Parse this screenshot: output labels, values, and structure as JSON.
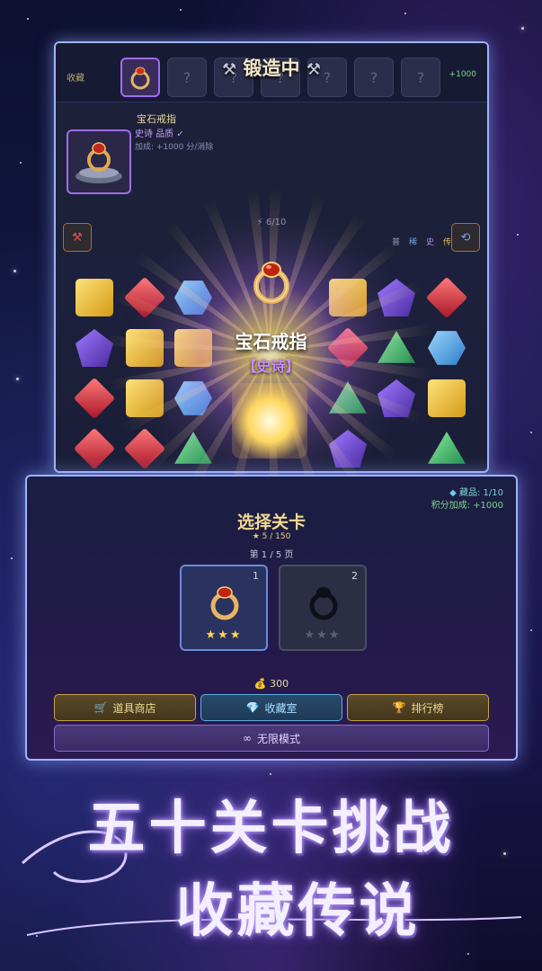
{
  "game": {
    "collect_label": "收藏",
    "forging_title": "锻造中",
    "collect_bonus": "+1000",
    "slot_placeholder": "?",
    "item": {
      "name": "宝石戒指",
      "rarity": "史诗 品质 ✓",
      "score": "加成: +1000 分/消除"
    },
    "rarity_tiers": [
      "普",
      "稀",
      "史",
      "传"
    ],
    "moves": "⚡ 6/10"
  },
  "reward": {
    "name": "宝石戒指",
    "rarity": "【史诗】"
  },
  "level_select": {
    "collect_count": "藏品: 1/10",
    "score_bonus": "积分加成: +1000",
    "title": "选择关卡",
    "stars_total": "★ 5 / 150",
    "page": "第 1 / 5 页",
    "levels": [
      {
        "num": "1",
        "stars": "★★★",
        "locked": false
      },
      {
        "num": "2",
        "stars": "★★★",
        "locked": true
      }
    ],
    "coins": "💰 300",
    "buttons": {
      "shop": "道具商店",
      "gallery": "收藏室",
      "rank": "排行榜",
      "endless": "无限模式"
    }
  },
  "promo": {
    "line1": "五十关卡挑战",
    "line2": "收藏传说"
  },
  "colors": {
    "panel_border": "#9fb4ff",
    "gold_text": "#f0d890",
    "epic_purple": "#c98cff"
  }
}
